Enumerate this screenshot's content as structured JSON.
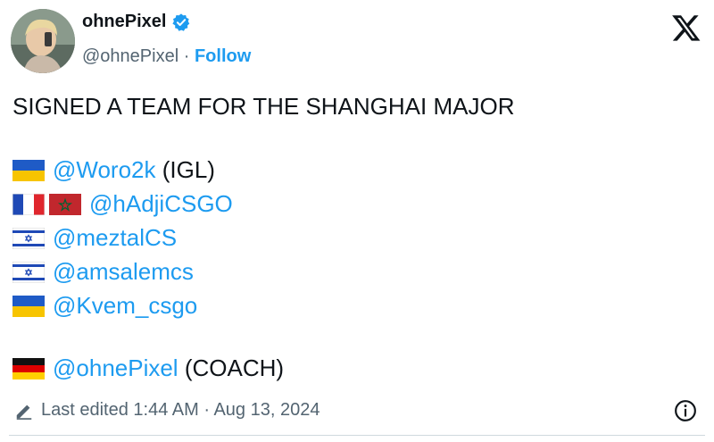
{
  "author": {
    "display_name": "ohnePixel",
    "handle": "@ohnePixel",
    "separator": "·",
    "follow_label": "Follow"
  },
  "icons": {
    "verified": "verified-badge-icon",
    "x_logo": "x-logo-icon",
    "edit": "pencil-icon",
    "info": "info-icon"
  },
  "colors": {
    "accent": "#1d9bf0",
    "text": "#0f1419",
    "muted": "#536471"
  },
  "tweet": {
    "headline": "SIGNED A TEAM FOR THE SHANGHAI MAJOR",
    "roster": [
      {
        "flags": [
          "ukraine"
        ],
        "mention": "@Woro2k",
        "suffix": " (IGL)"
      },
      {
        "flags": [
          "france",
          "morocco"
        ],
        "mention": "@hAdjiCSGO",
        "suffix": ""
      },
      {
        "flags": [
          "israel"
        ],
        "mention": "@meztalCS",
        "suffix": ""
      },
      {
        "flags": [
          "israel"
        ],
        "mention": "@amsalemcs",
        "suffix": ""
      },
      {
        "flags": [
          "ukraine"
        ],
        "mention": "@Kvem_csgo",
        "suffix": ""
      }
    ],
    "coach": {
      "flags": [
        "germany"
      ],
      "mention": "@ohnePixel",
      "suffix": " (COACH)"
    }
  },
  "footer": {
    "edited_label": "Last edited 1:44 AM · Aug 13, 2024"
  }
}
